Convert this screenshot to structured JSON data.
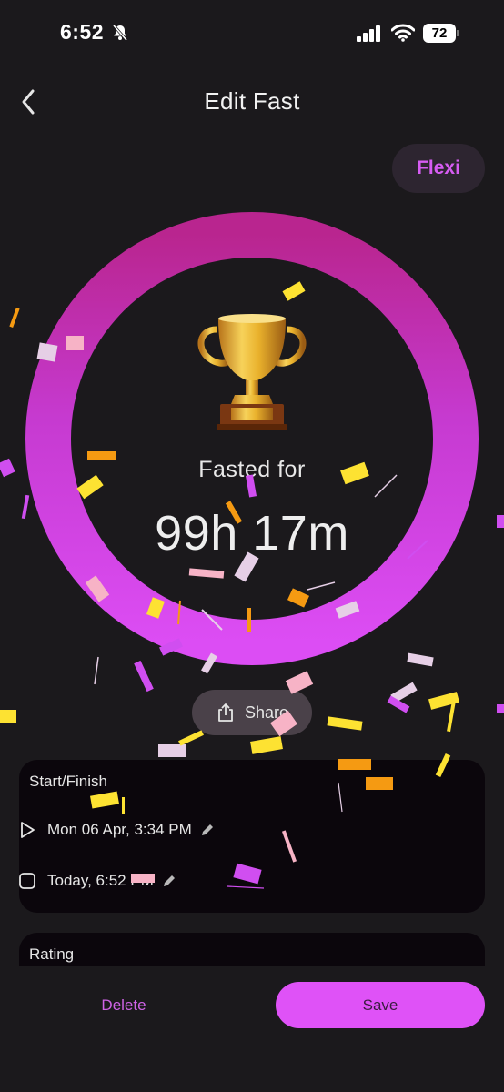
{
  "status_bar": {
    "time": "6:52",
    "battery": "72"
  },
  "header": {
    "title": "Edit Fast"
  },
  "badge": {
    "label": "Flexi"
  },
  "progress": {
    "fasted_label": "Fasted for",
    "duration": "99h 17m"
  },
  "share": {
    "label": "Share"
  },
  "start_finish": {
    "title": "Start/Finish",
    "start": "Mon 06 Apr, 3:34 PM",
    "finish": "Today, 6:52 PM"
  },
  "rating": {
    "title": "Rating"
  },
  "actions": {
    "delete_label": "Delete",
    "save_label": "Save"
  },
  "colors": {
    "accent": "#df52f7",
    "ring": "#c23fd6",
    "background": "#1b191c",
    "card": "#0b060c"
  },
  "icons": [
    "bell-slash-icon",
    "signal-icon",
    "wifi-icon",
    "battery-icon",
    "back-chevron-icon",
    "trophy-icon",
    "share-icon",
    "play-icon",
    "checkbox-icon",
    "pencil-icon"
  ]
}
